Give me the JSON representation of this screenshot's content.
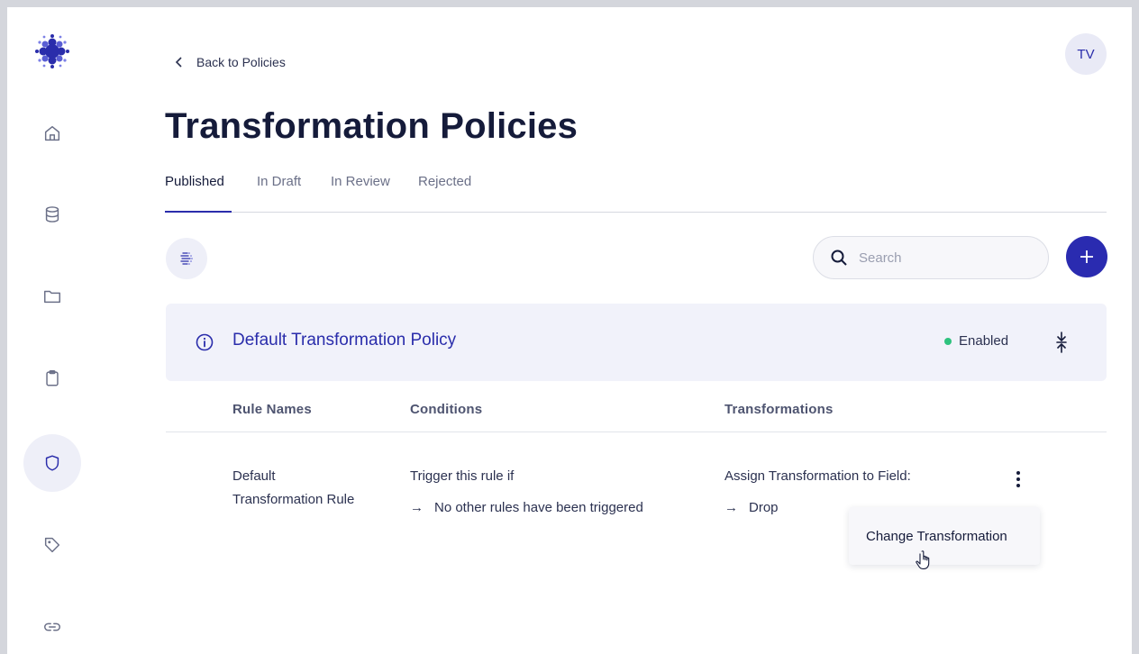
{
  "header": {
    "back_label": "Back to Policies",
    "avatar_initials": "TV",
    "page_title": "Transformation Policies"
  },
  "tabs": [
    {
      "label": "Published",
      "active": true
    },
    {
      "label": "In Draft",
      "active": false
    },
    {
      "label": "In Review",
      "active": false
    },
    {
      "label": "Rejected",
      "active": false
    }
  ],
  "sidebar": {
    "items": [
      {
        "icon": "home-icon"
      },
      {
        "icon": "database-icon"
      },
      {
        "icon": "folder-icon"
      },
      {
        "icon": "clipboard-icon"
      },
      {
        "icon": "shield-icon",
        "active": true
      },
      {
        "icon": "tag-icon"
      },
      {
        "icon": "link-icon"
      }
    ]
  },
  "toolbar": {
    "search_placeholder": "Search"
  },
  "policy": {
    "name": "Default Transformation Policy",
    "status": "Enabled",
    "status_color": "#2ec27e"
  },
  "table": {
    "headers": [
      "Rule Names",
      "Conditions",
      "Transformations"
    ],
    "rows": [
      {
        "rule_name_line1": "Default",
        "rule_name_line2": "Transformation Rule",
        "condition_intro": "Trigger this rule if",
        "condition": "No other rules have been triggered",
        "transformation_intro": "Assign Transformation to Field:",
        "transformation": "Drop"
      }
    ]
  },
  "context_menu": {
    "items": [
      "Change Transformation"
    ]
  },
  "colors": {
    "accent": "#2a2dab",
    "card_bg": "#f1f2fa"
  }
}
